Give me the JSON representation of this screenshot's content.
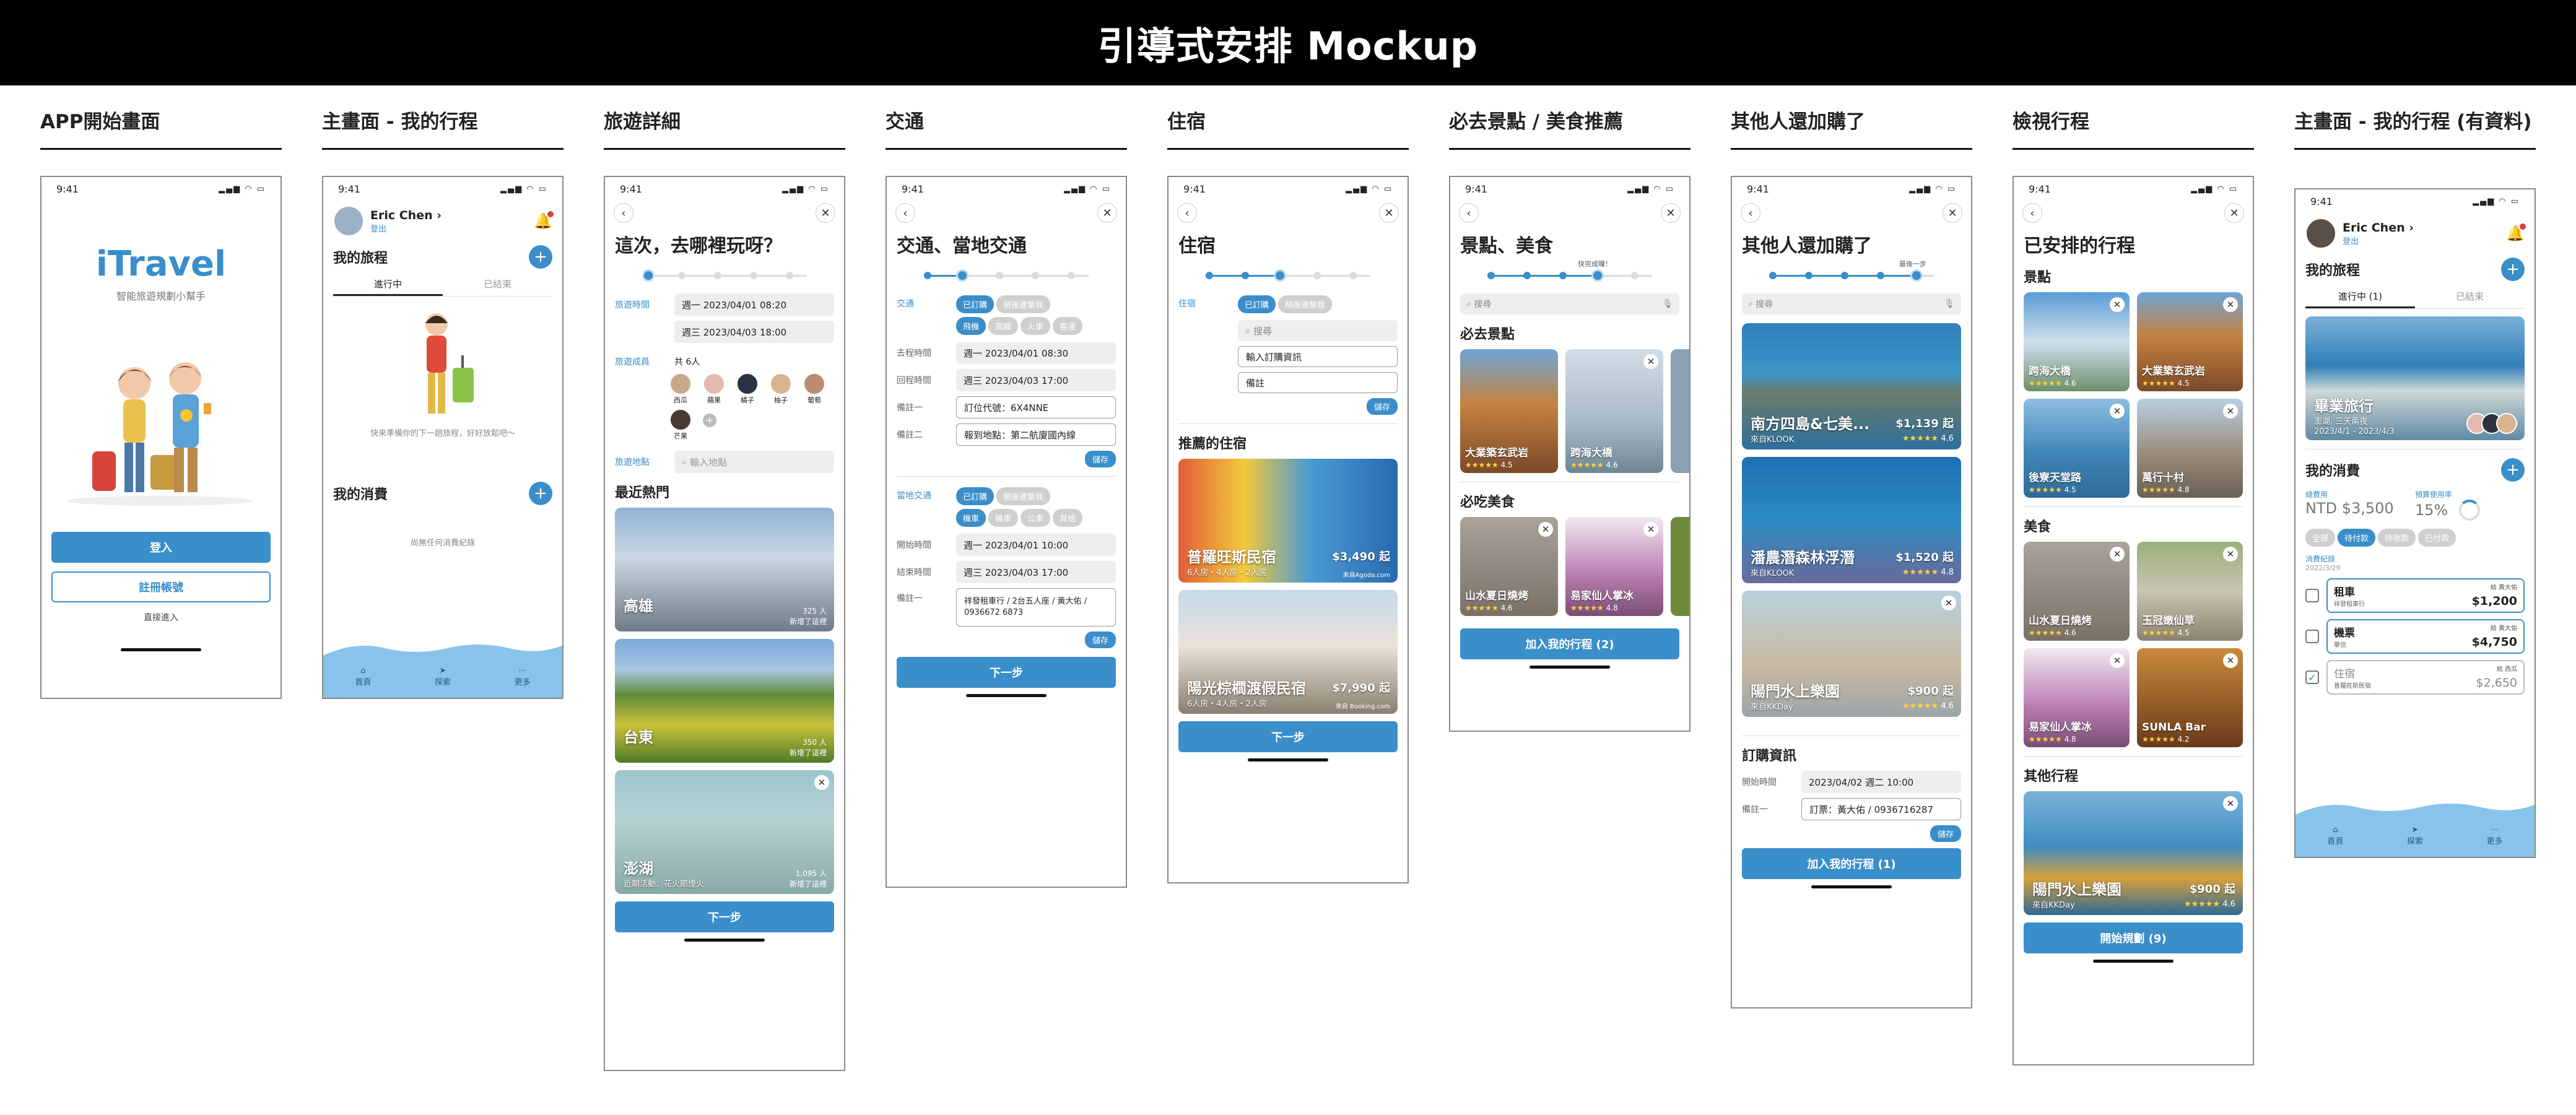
{
  "page_title": "引導式安排 Mockup",
  "status_time": "9:41",
  "columns": [
    "APP開始畫面",
    "主畫面 - 我的行程",
    "旅遊詳細",
    "交通",
    "住宿",
    "必去景點 / 美食推薦",
    "其他人還加購了",
    "檢視行程",
    "主畫面 - 我的行程 (有資料)"
  ],
  "splash": {
    "logo": "iTravel",
    "tagline": "智能旅遊規劃小幫手",
    "login": "登入",
    "register": "註冊帳號",
    "guest": "直接進入"
  },
  "home": {
    "user": "Eric Chen",
    "logout": "登出",
    "trips_title": "我的旅程",
    "tab_ongoing": "進行中",
    "tab_ongoing_count": "進行中 (1)",
    "tab_done": "已結束",
    "empty_trip": "快來準備你的下一趟旅程，好好放鬆吧～",
    "expense_title": "我的消費",
    "empty_expense": "尚無任何消費紀錄",
    "tab_home": "首頁",
    "tab_explore": "探索",
    "tab_more": "更多"
  },
  "detail": {
    "title": "這次，去哪裡玩呀？",
    "time_label": "旅遊時間",
    "start": "週一 2023/04/01  08:20",
    "end": "週三 2023/04/03  18:00",
    "member_label": "旅遊成員",
    "member_count": "共 6人",
    "members": [
      "西瓜",
      "蘋果",
      "橘子",
      "柚子",
      "葡萄",
      "芒果"
    ],
    "place_label": "旅遊地點",
    "place_placeholder": "輸入地點",
    "hot_title": "最近熱門",
    "hot": [
      {
        "name": "高雄",
        "count": "325 人",
        "note": "新增了這裡"
      },
      {
        "name": "台東",
        "count": "350 人",
        "note": "新增了這裡"
      },
      {
        "name": "澎湖",
        "sub": "近期活動：花火節煙火",
        "count": "1,095 人",
        "note": "新增了這裡"
      }
    ],
    "next": "下一步"
  },
  "transport": {
    "title": "交通、當地交通",
    "label": "交通",
    "booked": "已訂購",
    "later": "稍後連繫我",
    "modes": [
      "飛機",
      "高鐵",
      "火車",
      "客運"
    ],
    "depart_label": "去程時間",
    "depart": "週一 2023/04/01  08:30",
    "return_label": "回程時間",
    "return": "週三 2023/04/03  17:00",
    "note1_label": "備註一",
    "note1": "訂位代號：6X4NNE",
    "note2_label": "備註二",
    "note2": "報到地點：第二航廈國內線",
    "save": "儲存",
    "local_label": "當地交通",
    "local_modes": [
      "機車",
      "機車",
      "公車",
      "其他"
    ],
    "start_label": "開始時間",
    "start": "週一 2023/04/01  10:00",
    "end_label": "結束時間",
    "end": "週三 2023/04/03  17:00",
    "note_label": "備註一",
    "note": "祥發租車行 / 2台五人座 / 黃大佑 / 0936672 6873",
    "next": "下一步"
  },
  "stay": {
    "title": "住宿",
    "label": "住宿",
    "booked": "已訂購",
    "later": "稍後連繫我",
    "search": "搜尋",
    "order": "輸入訂購資訊",
    "note": "備註",
    "save": "儲存",
    "rec_title": "推薦的住宿",
    "items": [
      {
        "name": "普羅旺斯民宿",
        "sub": "6人房・4人房・2人房",
        "price": "$3,490 起",
        "source": "來自Agoda.com"
      },
      {
        "name": "陽光棕櫚渡假民宿",
        "sub": "6人房・4人房・2人房",
        "price": "$7,990 起",
        "source": "來自 Booking.com"
      }
    ],
    "next": "下一步"
  },
  "spots": {
    "title": "景點、美食",
    "tip": "快完成囉！",
    "search": "搜尋",
    "must_go": "必去景點",
    "go_items": [
      {
        "name": "大業築玄武岩",
        "rating": "4.5"
      },
      {
        "name": "跨海大橋",
        "rating": "4.6"
      }
    ],
    "must_eat": "必吃美食",
    "eat_items": [
      {
        "name": "山水夏日燒烤",
        "rating": "4.6"
      },
      {
        "name": "易家仙人掌冰",
        "rating": "4.8"
      }
    ],
    "add": "加入我的行程 (2)"
  },
  "extra": {
    "title": "其他人還加購了",
    "tip": "最後一步",
    "search": "搜尋",
    "items": [
      {
        "name": "南方四島&七美...",
        "price": "$1,139 起",
        "source": "來自KLOOK",
        "rating": "4.6"
      },
      {
        "name": "潘農潛森林浮潛",
        "price": "$1,520 起",
        "source": "來自KLOOK",
        "rating": "4.8"
      },
      {
        "name": "陽門水上樂園",
        "price": "$900 起",
        "source": "來自KKDay",
        "rating": "4.6"
      }
    ],
    "order_title": "訂購資訊",
    "start_label": "開始時間",
    "start": "2023/04/02  週二  10:00",
    "note_label": "備註一",
    "note": "訂票：黃大佑 / 0936716287",
    "save": "儲存",
    "add": "加入我的行程 (1)"
  },
  "review": {
    "title": "已安排的行程",
    "spots_label": "景點",
    "spots": [
      {
        "name": "跨海大橋",
        "rating": "4.6"
      },
      {
        "name": "大業築玄武岩",
        "rating": "4.5"
      },
      {
        "name": "後寮天堂路",
        "rating": "4.5"
      },
      {
        "name": "萬行十村",
        "rating": "4.8"
      }
    ],
    "food_label": "美食",
    "food": [
      {
        "name": "山水夏日燒烤",
        "rating": "4.6"
      },
      {
        "name": "玉冠嫩仙草",
        "rating": "4.5"
      },
      {
        "name": "易家仙人掌冰",
        "rating": "4.8"
      },
      {
        "name": "SUNLA Bar",
        "rating": "4.2"
      }
    ],
    "other_label": "其他行程",
    "other": {
      "name": "陽門水上樂園",
      "price": "$900 起",
      "source": "來自KKDay",
      "rating": "4.6"
    },
    "start": "開始規劃 (9)"
  },
  "home2": {
    "trip_name": "畢業旅行",
    "trip_sub": "澎湖, 三天兩夜",
    "trip_date": "2023/4/1 - 2023/4/3",
    "total_label": "總費用",
    "total": "NTD $3,500",
    "budget_label": "預算使用率",
    "budget": "15%",
    "filters": [
      "全部",
      "待付款",
      "待收款",
      "已付款"
    ],
    "log_label": "消費紀錄",
    "log_date": "2022/3/29",
    "expenses": [
      {
        "name": "租車",
        "sub": "祥發租車行",
        "who": "給 黃大佑",
        "amount": "$1,200",
        "checked": ""
      },
      {
        "name": "機票",
        "sub": "華信",
        "who": "給 黃大佑",
        "amount": "$4,750",
        "checked": ""
      },
      {
        "name": "住宿",
        "sub": "普羅旺斯民宿",
        "who": "給 西瓜",
        "amount": "$2,650",
        "checked": "✓"
      }
    ]
  },
  "colors": {
    "accent": "#3a8ec9",
    "tabbar": "#88c3ea",
    "star": "#ffd43a"
  }
}
